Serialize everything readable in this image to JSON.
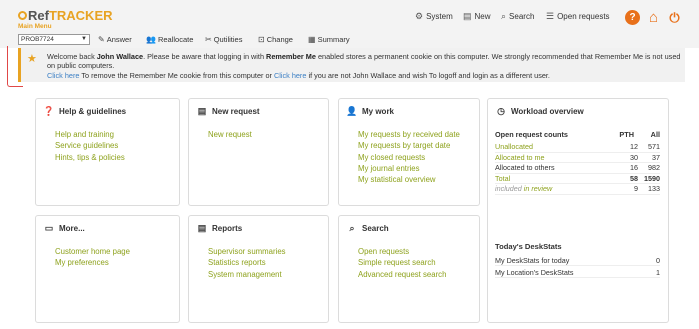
{
  "app": {
    "logo_ref": "Ref",
    "logo_tracker": "TRACKER",
    "main_menu": "Main Menu"
  },
  "top_menu": {
    "system": "System",
    "new": "New",
    "search": "Search",
    "open_requests": "Open requests"
  },
  "toolbar": {
    "request_id": "PROB7724",
    "answer": "Answer",
    "reallocate": "Reallocate",
    "qutilities": "Qutilities",
    "change": "Change",
    "summary": "Summary"
  },
  "banner": {
    "welcome": "Welcome back ",
    "user": "John Wallace",
    "msg1": ". Please be aware that logging in with ",
    "remember": "Remember Me",
    "msg2": " enabled stores a permanent cookie on this computer. We strongly recommended that Remember Me is not used on public computers.",
    "click_here_1": "Click here",
    "msg3": " To remove the Remember Me cookie from this computer or ",
    "click_here_2": "Click here",
    "msg4": " if you are not John Wallace and wish To logoff and login as a different user."
  },
  "cards": {
    "help": {
      "title": "Help & guidelines",
      "links": [
        "Help and training",
        "Service guidelines",
        "Hints, tips & policies"
      ]
    },
    "new_request": {
      "title": "New request",
      "links": [
        "New request"
      ]
    },
    "my_work": {
      "title": "My work",
      "links": [
        "My requests by received date",
        "My requests by target date",
        "My closed requests",
        "My journal entries",
        "My statistical overview"
      ]
    },
    "more": {
      "title": "More...",
      "links": [
        "Customer home page",
        "My preferences"
      ]
    },
    "reports": {
      "title": "Reports",
      "links": [
        "Supervisor summaries",
        "Statistics reports",
        "System management"
      ]
    },
    "search": {
      "title": "Search",
      "links": [
        "Open requests",
        "Simple request search",
        "Advanced request search"
      ]
    }
  },
  "workload": {
    "title": "Workload overview",
    "header": "Open request counts",
    "col1": "PTH",
    "col2": "All",
    "rows": [
      {
        "label": "Unallocated",
        "pth": "12",
        "all": "571"
      },
      {
        "label": "Allocated to me",
        "pth": "30",
        "all": "37"
      },
      {
        "label": "Allocated to others",
        "pth": "16",
        "all": "982"
      },
      {
        "label": "Total",
        "pth": "58",
        "all": "1590"
      }
    ],
    "included_label": "included",
    "included_suffix": "in review",
    "included_pth": "9",
    "included_all": "133"
  },
  "deskstats": {
    "title": "Today's DeskStats",
    "rows": [
      {
        "label": "My DeskStats for today",
        "value": "0"
      },
      {
        "label": "My Location's DeskStats",
        "value": "1"
      }
    ]
  },
  "colors": {
    "accent": "#e8a323",
    "link_green": "#8ea21d",
    "help_orange": "#e8701a",
    "home_orange": "#e8701a"
  }
}
